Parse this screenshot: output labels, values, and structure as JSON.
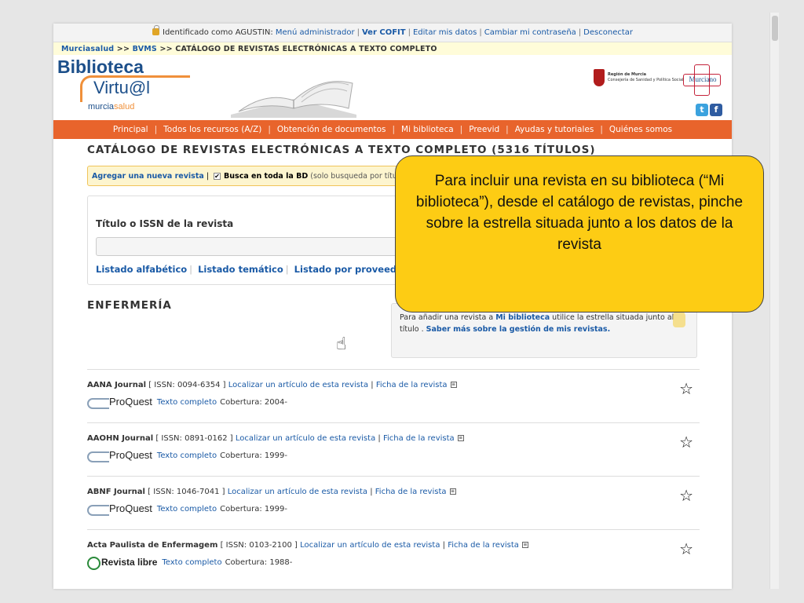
{
  "topbar": {
    "identified_prefix": "Identificado como AGUSTIN:",
    "links": [
      "Menú administrador",
      "Ver COFIT",
      "Editar mis datos",
      "Cambiar mi contraseña",
      "Desconectar"
    ]
  },
  "breadcrumb": {
    "items": [
      "Murciasalud",
      "BVMS"
    ],
    "current": "CATÁLOGO DE REVISTAS ELECTRÓNICAS A TEXTO COMPLETO"
  },
  "header": {
    "logo_line1": "Biblioteca",
    "logo_line2": "Virtu@l",
    "logo_sub_a": "murcia",
    "logo_sub_b": "salud",
    "region_line1": "Región de Murcia",
    "region_line2": "Consejería de Sanidad y Política Social",
    "sms_label": "Murciano"
  },
  "nav": {
    "items": [
      "Principal",
      "Todos los recursos (A/Z)",
      "Obtención de documentos",
      "Mi biblioteca",
      "Preevid",
      "Ayudas y tutoriales",
      "Quiénes somos"
    ]
  },
  "catalog": {
    "title": "CATÁLOGO DE REVISTAS ELECTRÓNICAS A TEXTO COMPLETO (5316 TÍTULOS)",
    "add_link": "Agregar una nueva revista",
    "search_all": "Busca en toda la BD",
    "search_all_note": "(solo busqueda por título y/o issn)",
    "search_label": "Título o ISSN de la revista",
    "links": [
      "Listado alfabético",
      "Listado temático",
      "Listado por proveedor"
    ]
  },
  "section": {
    "title": "ENFERMERÍA"
  },
  "info": {
    "text_a": "Para añadir una revista a",
    "link_a": "Mi biblioteca",
    "text_b": "utilice la estrella situada junto al título .",
    "link_b": "Saber más sobre la gestión de mis revistas."
  },
  "journals": [
    {
      "name": "AANA Journal",
      "issn": "[ ISSN: 0094-6354 ]",
      "locate": "Localizar un artículo de esta revista",
      "ficha": "Ficha de la revista",
      "provider": "ProQuest",
      "fulltext": "Texto completo",
      "coverage": "Cobertura: 2004-"
    },
    {
      "name": "AAOHN Journal",
      "issn": "[ ISSN: 0891-0162 ]",
      "locate": "Localizar un artículo de esta revista",
      "ficha": "Ficha de la revista",
      "provider": "ProQuest",
      "fulltext": "Texto completo",
      "coverage": "Cobertura: 1999-"
    },
    {
      "name": "ABNF Journal",
      "issn": "[ ISSN: 1046-7041 ]",
      "locate": "Localizar un artículo de esta revista",
      "ficha": "Ficha de la revista",
      "provider": "ProQuest",
      "fulltext": "Texto completo",
      "coverage": "Cobertura: 1999-"
    },
    {
      "name": "Acta Paulista de Enfermagem",
      "issn": "[ ISSN: 0103-2100 ]",
      "locate": "Localizar un artículo de esta revista",
      "ficha": "Ficha de la revista",
      "provider": "Revista libre",
      "fulltext": "Texto completo",
      "coverage": "Cobertura: 1988-"
    }
  ],
  "callout": {
    "text": "Para incluir una revista en su biblioteca (“Mi biblioteca”), desde el catálogo de revistas, pinche sobre la estrella situada junto a los datos de la revista"
  },
  "colors": {
    "nav": "#e8642c",
    "link": "#1a5aa6",
    "callout": "#fdcc14"
  },
  "icons": {
    "star": "☆",
    "hand": "☝"
  }
}
